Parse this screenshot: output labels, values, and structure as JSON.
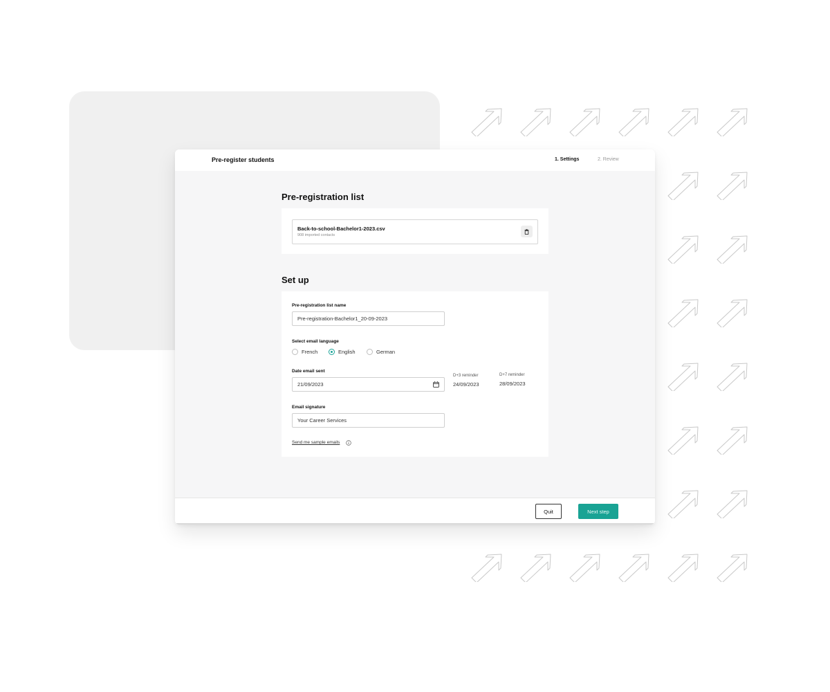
{
  "header": {
    "title": "Pre-register students",
    "steps": [
      {
        "label": "1. Settings",
        "active": true
      },
      {
        "label": "2. Review",
        "active": false
      }
    ]
  },
  "preregistration_list": {
    "heading": "Pre-registration list",
    "file_name": "Back-to-school-Bachelor1-2023.csv",
    "file_info": "908 imported contacts",
    "delete_icon": "trash-icon"
  },
  "setup": {
    "heading": "Set up",
    "list_name": {
      "label": "Pre-registration list name",
      "value": "Pre-registration-Bachelor1_20-09-2023"
    },
    "language": {
      "label": "Select email language",
      "options": [
        "French",
        "English",
        "German"
      ],
      "selected": "English"
    },
    "date": {
      "label": "Date email sent",
      "value": "21/09/2023",
      "icon": "calendar-icon",
      "reminders": [
        {
          "label": "D+3 reminder",
          "date": "24/09/2023"
        },
        {
          "label": "D+7 reminder",
          "date": "28/09/2023"
        }
      ]
    },
    "signature": {
      "label": "Email signature",
      "value": "Your Career Services"
    },
    "sample_link": "Send me sample emails",
    "info_icon": "info-icon"
  },
  "footer": {
    "quit_label": "Quit",
    "next_label": "Next step"
  },
  "colors": {
    "accent": "#19a394",
    "background_card": "#f0f0f0",
    "window_body": "#f6f6f7"
  }
}
